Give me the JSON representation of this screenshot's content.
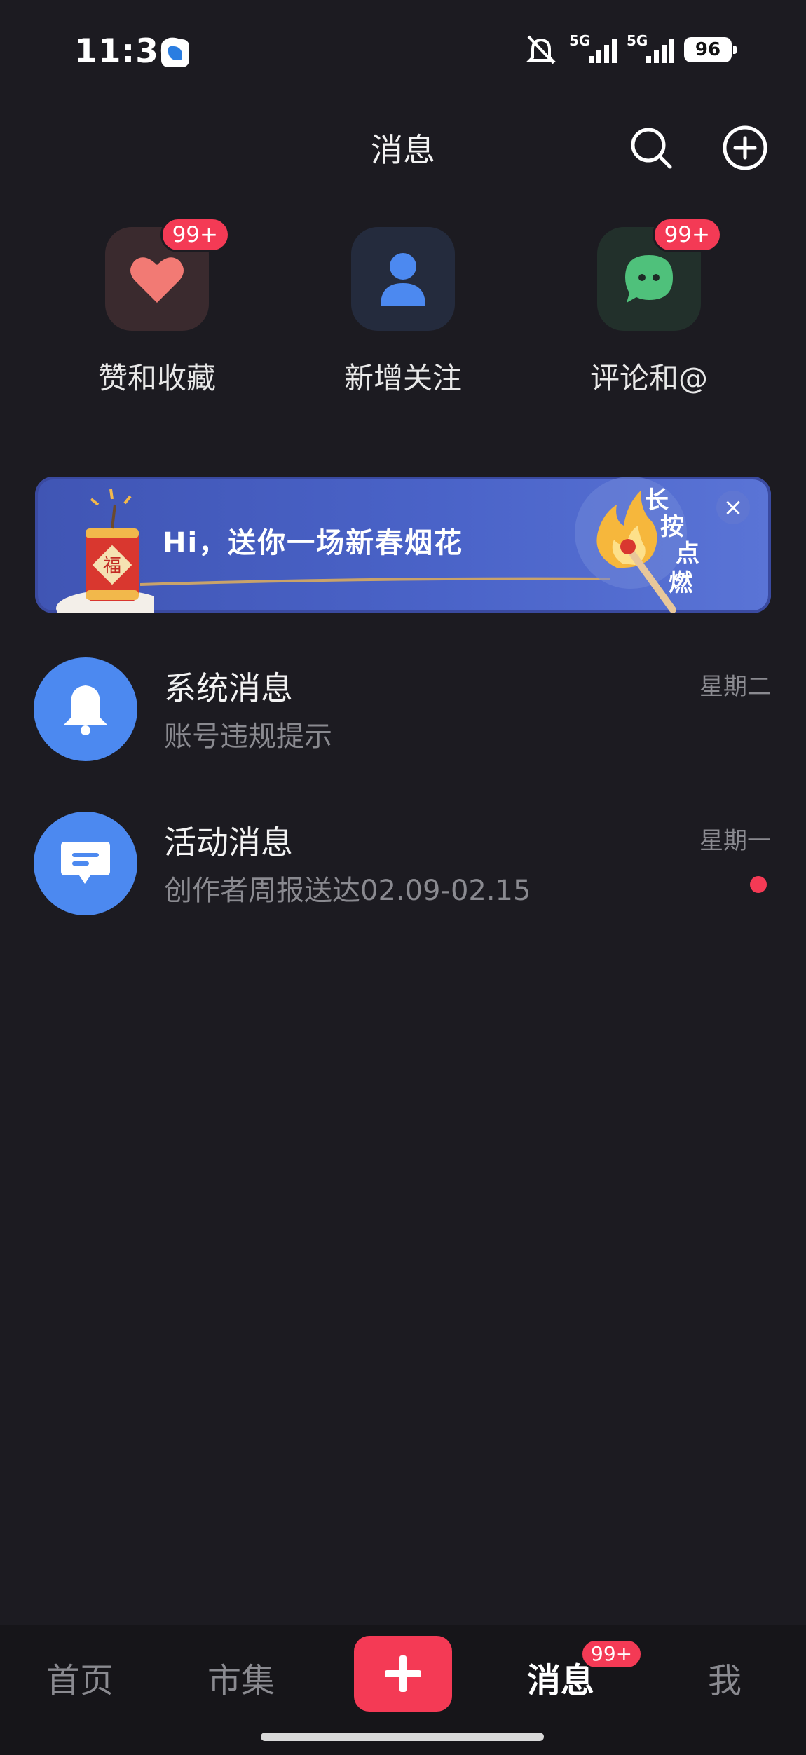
{
  "status_bar": {
    "time": "11:36",
    "signal1": "5G",
    "signal2": "5G",
    "battery": "96"
  },
  "header": {
    "title": "消息"
  },
  "quick_entries": [
    {
      "label": "赞和收藏",
      "badge": "99+"
    },
    {
      "label": "新增关注",
      "badge": ""
    },
    {
      "label": "评论和@",
      "badge": "99+"
    }
  ],
  "banner": {
    "text": "Hi，送你一场新春烟花",
    "chars": [
      "长",
      "按",
      "点",
      "燃"
    ],
    "close": "×",
    "fu": "福"
  },
  "messages": [
    {
      "title": "系统消息",
      "subtitle": "账号违规提示",
      "time": "星期二",
      "unread": false
    },
    {
      "title": "活动消息",
      "subtitle": "创作者周报送达02.09-02.15",
      "time": "星期一",
      "unread": true
    }
  ],
  "tabbar": {
    "items": [
      "首页",
      "市集",
      "消息",
      "我"
    ],
    "active": "消息",
    "messages_badge": "99+"
  },
  "colors": {
    "background": "#1c1b21",
    "accent": "#f43a55",
    "blue": "#4c89f0"
  }
}
